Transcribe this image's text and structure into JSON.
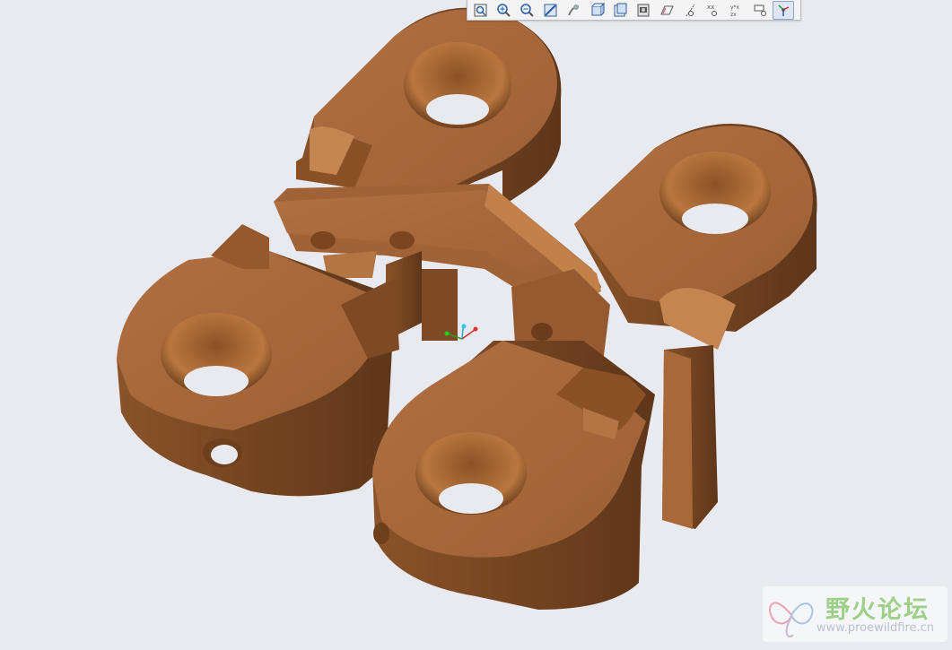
{
  "toolbar": {
    "tools": [
      {
        "name": "refit-icon"
      },
      {
        "name": "zoom-in-icon"
      },
      {
        "name": "zoom-out-icon"
      },
      {
        "name": "repaint-icon"
      },
      {
        "name": "reorient-icon"
      },
      {
        "name": "saved-views-icon"
      },
      {
        "name": "display-style-icon"
      },
      {
        "name": "view-manager-icon"
      },
      {
        "name": "plane-display-icon"
      },
      {
        "name": "axis-display-icon"
      },
      {
        "name": "point-display-icon"
      },
      {
        "name": "csys-display-icon"
      },
      {
        "name": "annotation-display-icon"
      },
      {
        "name": "spin-center-icon",
        "active": true
      }
    ]
  },
  "watermark": {
    "title": "野火论坛",
    "url": "www.proewildfire.cn"
  },
  "colors": {
    "background": "#e9eaef",
    "part_top": "#a8683a",
    "part_side": "#7d4a25",
    "part_dark": "#5c3519"
  }
}
